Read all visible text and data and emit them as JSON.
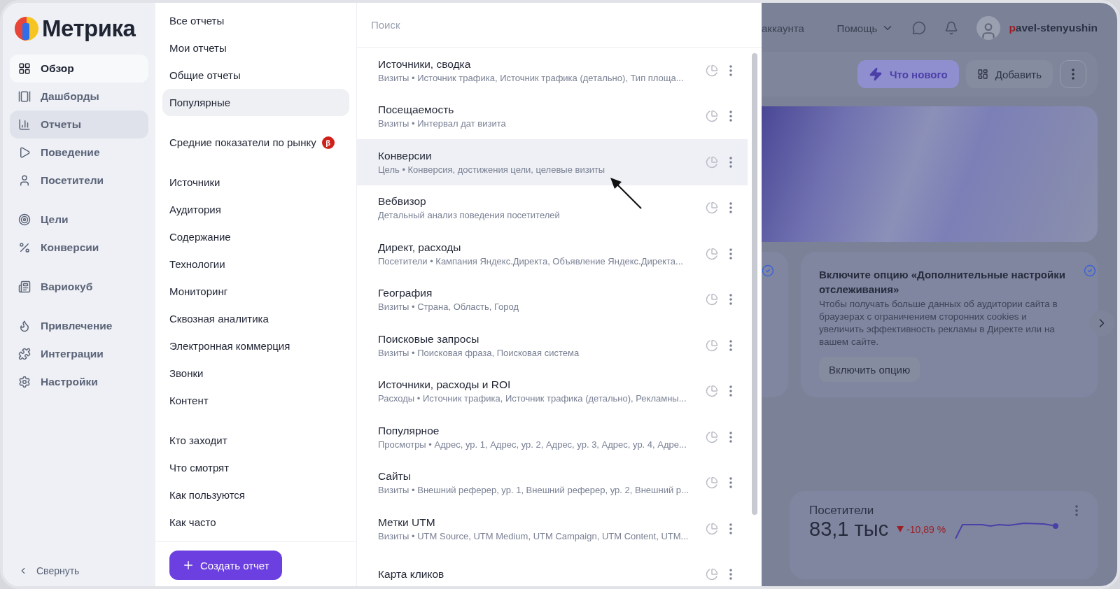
{
  "logo": {
    "text": "Метрика"
  },
  "nav": [
    {
      "items": [
        {
          "label": "Обзор",
          "kind": "grid",
          "selected": false,
          "highlighted": true
        },
        {
          "label": "Дашборды",
          "kind": "dashboards",
          "selected": false,
          "highlighted": false
        },
        {
          "label": "Отчеты",
          "kind": "chart",
          "selected": true,
          "highlighted": false
        },
        {
          "label": "Поведение",
          "kind": "play",
          "selected": false,
          "highlighted": false
        },
        {
          "label": "Посетители",
          "kind": "user",
          "selected": false,
          "highlighted": false
        }
      ]
    },
    {
      "items": [
        {
          "label": "Цели",
          "kind": "target",
          "selected": false,
          "highlighted": false
        },
        {
          "label": "Конверсии",
          "kind": "percent",
          "selected": false,
          "highlighted": false
        }
      ]
    },
    {
      "items": [
        {
          "label": "Вариокуб",
          "kind": "cube",
          "selected": false,
          "highlighted": false
        }
      ]
    },
    {
      "items": [
        {
          "label": "Привлечение",
          "kind": "flame",
          "selected": false,
          "highlighted": false
        },
        {
          "label": "Интеграции",
          "kind": "puzzle",
          "selected": false,
          "highlighted": false
        },
        {
          "label": "Настройки",
          "kind": "gear",
          "selected": false,
          "highlighted": false
        }
      ]
    }
  ],
  "collapse": {
    "label": "Свернуть"
  },
  "report_menu": {
    "groups": [
      {
        "items": [
          {
            "label": "Все отчеты",
            "selected": false
          },
          {
            "label": "Мои отчеты",
            "selected": false
          },
          {
            "label": "Общие отчеты",
            "selected": false
          },
          {
            "label": "Популярные",
            "selected": true
          }
        ]
      },
      {
        "items": [
          {
            "label": "Средние показатели по рынку",
            "selected": false,
            "badge": "β"
          }
        ]
      },
      {
        "items": [
          {
            "label": "Источники",
            "selected": false
          },
          {
            "label": "Аудитория",
            "selected": false
          },
          {
            "label": "Содержание",
            "selected": false
          },
          {
            "label": "Технологии",
            "selected": false
          },
          {
            "label": "Мониторинг",
            "selected": false
          },
          {
            "label": "Сквозная аналитика",
            "selected": false
          },
          {
            "label": "Электронная коммерция",
            "selected": false
          },
          {
            "label": "Звонки",
            "selected": false
          },
          {
            "label": "Контент",
            "selected": false
          }
        ]
      },
      {
        "items": [
          {
            "label": "Кто заходит",
            "selected": false
          },
          {
            "label": "Что смотрят",
            "selected": false
          },
          {
            "label": "Как пользуются",
            "selected": false
          },
          {
            "label": "Как часто",
            "selected": false
          }
        ]
      }
    ],
    "create_button": "Создать отчет"
  },
  "search": {
    "placeholder": "Поиск"
  },
  "reports": [
    {
      "title": "Источники, сводка",
      "description": "Визиты • Источник трафика, Источник трафика (детально), Тип площа...",
      "selected": false
    },
    {
      "title": "Посещаемость",
      "description": "Визиты • Интервал дат визита",
      "selected": false
    },
    {
      "title": "Конверсии",
      "description": "Цель • Конверсия, достижения цели, целевые визиты",
      "selected": true
    },
    {
      "title": "Вебвизор",
      "description": "Детальный анализ поведения посетителей",
      "selected": false
    },
    {
      "title": "Директ, расходы",
      "description": "Посетители • Кампания Яндекс.Директа, Объявление Яндекс.Директа...",
      "selected": false
    },
    {
      "title": "География",
      "description": "Визиты • Страна, Область, Город",
      "selected": false
    },
    {
      "title": "Поисковые запросы",
      "description": "Визиты • Поисковая фраза, Поисковая система",
      "selected": false
    },
    {
      "title": "Источники, расходы и ROI",
      "description": "Расходы • Источник трафика, Источник трафика (детально), Рекламны...",
      "selected": false
    },
    {
      "title": "Популярное",
      "description": "Просмотры • Адрес, ур. 1, Адрес, ур. 2, Адрес, ур. 3, Адрес, ур. 4, Адре...",
      "selected": false
    },
    {
      "title": "Сайты",
      "description": "Визиты • Внешний реферер, ур. 1, Внешний реферер, ур. 2, Внешний р...",
      "selected": false
    },
    {
      "title": "Метки UTM",
      "description": "Визиты • UTM Source, UTM Medium, UTM Campaign, UTM Content, UTM...",
      "selected": false
    },
    {
      "title": "Карта кликов",
      "selected": false
    }
  ],
  "background_page": {
    "header": {
      "account_link": "аккаунта",
      "help": "Помощь",
      "user": "pavel-stenyushin"
    },
    "toolbar": {
      "whats_new": "Что нового",
      "add": "Добавить"
    },
    "notice": {
      "title": "Включите опцию «Дополнительные настройки отслеживания»",
      "text": "Чтобы получать больше данных об аудитории сайта в браузерах с ограничением сторонних cookies и увеличить эффективность рекламы в Директе или на вашем сайте.",
      "button": "Включить опцию"
    },
    "metric": {
      "title": "Посетители",
      "value": "83,1 тыс",
      "change": "-10,89 %"
    }
  }
}
